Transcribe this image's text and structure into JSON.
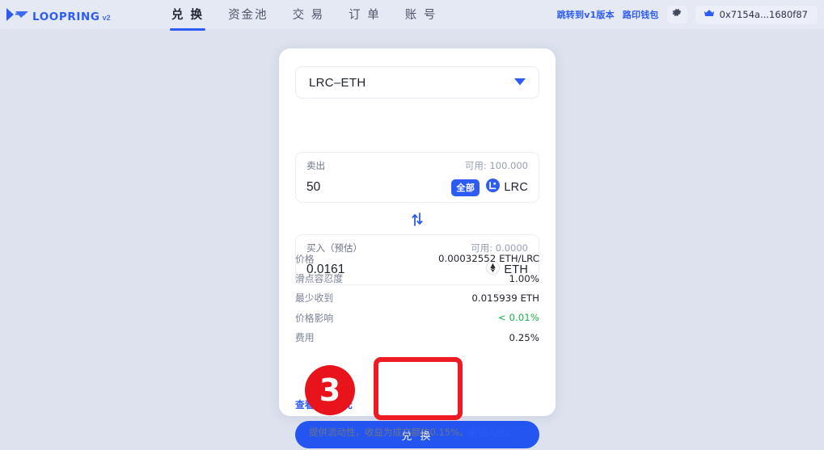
{
  "header": {
    "brand": {
      "name": "LOOPRING",
      "version": "v2",
      "logo_icon": "loopring-arrow-logo",
      "color": "#2d5cf5"
    },
    "nav": [
      {
        "label": "兑 换",
        "active": true
      },
      {
        "label": "资金池",
        "active": false
      },
      {
        "label": "交 易",
        "active": false
      },
      {
        "label": "订 单",
        "active": false
      },
      {
        "label": "账 号",
        "active": false
      }
    ],
    "links": [
      {
        "label": "跳转到v1版本"
      },
      {
        "label": "路印钱包"
      }
    ],
    "settings_icon": "gear-icon",
    "wallet": {
      "icon": "crown-icon",
      "address": "0x7154a...1680f87"
    }
  },
  "swap_card": {
    "pair": {
      "value": "LRC–ETH",
      "chevron_icon": "chevron-down-icon"
    },
    "sell": {
      "label": "卖出",
      "available_label": "可用: 100.000",
      "amount": "50",
      "max_label": "全部",
      "token_symbol": "LRC",
      "token_icon": "lrc-token-icon"
    },
    "swap_direction_icon": "swap-vertical-icon",
    "buy": {
      "label": "买入（预估）",
      "available_label": "可用: 0.0000",
      "amount": "0.0161",
      "token_symbol": "ETH",
      "token_icon": "eth-token-icon"
    },
    "details": [
      {
        "label": "价格",
        "value": "0.00032552 ETH/LRC",
        "highlight": false
      },
      {
        "label": "滑点容忍度",
        "value": "1.00%",
        "highlight": false
      },
      {
        "label": "最少收到",
        "value": "0.015939 ETH",
        "highlight": false
      },
      {
        "label": "价格影响",
        "value": "< 0.01%",
        "highlight": true
      },
      {
        "label": "费用",
        "value": "0.25%",
        "highlight": false
      }
    ],
    "history_link": "查看历史委托",
    "submit_label": "兑 换"
  },
  "footer": {
    "note_text": "提供流动性，收益为成交额的0.15%。",
    "note_link": "前往入金。"
  },
  "annotations": {
    "step_number": "3",
    "circle_color": "#e8131b",
    "highlight_box_color": "#ef1b22"
  }
}
